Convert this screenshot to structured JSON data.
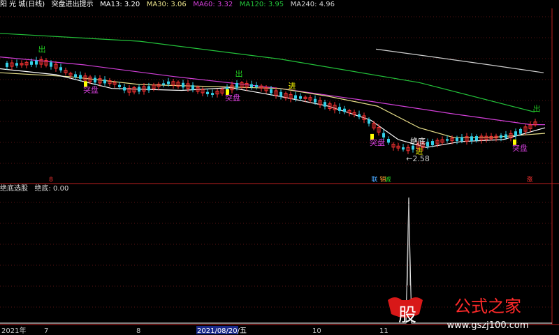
{
  "header": {
    "stock": "阳 光 城(日线)",
    "indicator": "突盘进出提示",
    "ma": [
      {
        "label": "MA13: 3.20",
        "color": "#ffffff"
      },
      {
        "label": "MA30: 3.06",
        "color": "#e8e08a"
      },
      {
        "label": "MA60: 3.32",
        "color": "#d23fd8"
      },
      {
        "label": "MA120: 3.95",
        "color": "#23c23a"
      },
      {
        "label": "MA240: 4.96",
        "color": "#cfcfcf"
      }
    ]
  },
  "sub_header": {
    "name": "绝底选股",
    "value": "绝底: 0.00"
  },
  "watermark": {
    "logo": "股",
    "site_name": "公式之家",
    "url": "www.gszj100.com"
  },
  "chart_data": [
    {
      "type": "candlestick",
      "ylim": [
        1.8,
        6.2
      ],
      "annotations": [
        "出",
        "突盘",
        "出",
        "突盘",
        "进",
        "突盘",
        "←2.58",
        "绝底",
        "进",
        "出",
        "突盘"
      ],
      "low_label": "←2.58",
      "bottom_markers": [
        "8",
        "联",
        "锦",
        "诚",
        "涨"
      ],
      "ma_lines": [
        {
          "name": "MA13",
          "color": "#ffffff"
        },
        {
          "name": "MA30",
          "color": "#e8e08a"
        },
        {
          "name": "MA60",
          "color": "#d23fd8"
        },
        {
          "name": "MA120",
          "color": "#23c23a"
        },
        {
          "name": "MA240",
          "color": "#cfcfcf"
        }
      ],
      "colors": {
        "up": "#ff3333",
        "down": "#33d0e8"
      }
    },
    {
      "type": "line",
      "series": [
        {
          "name": "绝底",
          "peak": 1.0,
          "current": 0.0
        }
      ],
      "x_tick_labels": [
        "2021年",
        "7",
        "8",
        "2021/08/20/五",
        "10",
        "11"
      ]
    }
  ]
}
